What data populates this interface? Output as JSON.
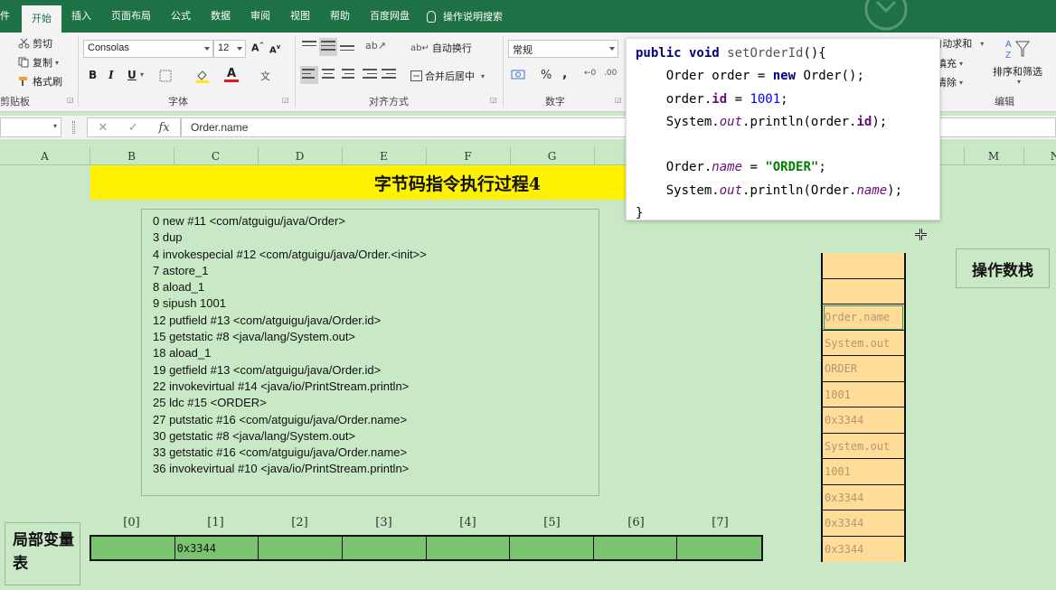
{
  "ribbon": {
    "tabs": [
      "件",
      "开始",
      "插入",
      "页面布局",
      "公式",
      "数据",
      "审阅",
      "视图",
      "帮助",
      "百度网盘",
      "操作说明搜索"
    ],
    "active_tab": "开始",
    "clipboard": {
      "cut": "剪切",
      "copy": "复制",
      "painter": "格式刷",
      "label": "剪贴板"
    },
    "font": {
      "name": "Consolas",
      "size": "12",
      "label": "字体",
      "bold": "B",
      "italic": "I",
      "underline": "U"
    },
    "align": {
      "wrap": "自动换行",
      "merge": "合并后居中",
      "label": "对齐方式"
    },
    "number": {
      "format": "常规",
      "percent": "%",
      "comma": ",",
      "label": "数字"
    },
    "edit": {
      "autosum": "自动求和",
      "fill": "填充",
      "clear": "清除",
      "sort": "排序和筛选",
      "label": "编辑"
    }
  },
  "formula_bar": {
    "cancel": "✕",
    "confirm": "✓",
    "fx": "fx",
    "content": "Order.name"
  },
  "columns": [
    "A",
    "B",
    "C",
    "D",
    "E",
    "F",
    "G",
    "M",
    "N"
  ],
  "sheet_title": "字节码指令执行过程4",
  "instructions": [
    "0 new #11 <com/atguigu/java/Order>",
    "3 dup",
    "4 invokespecial #12 <com/atguigu/java/Order.<init>>",
    "7 astore_1",
    "8 aload_1",
    "9 sipush 1001",
    "12 putfield #13 <com/atguigu/java/Order.id>",
    "15 getstatic #8 <java/lang/System.out>",
    "18 aload_1",
    "19 getfield #13 <com/atguigu/java/Order.id>",
    "22 invokevirtual #14 <java/io/PrintStream.println>",
    "25 ldc #15 <ORDER>",
    "27 putstatic #16 <com/atguigu/java/Order.name>",
    "30 getstatic #8 <java/lang/System.out>",
    "33 getstatic #16 <com/atguigu/java/Order.name>",
    "36 invokevirtual #10 <java/io/PrintStream.println>"
  ],
  "operand_stack": {
    "label": "操作数栈",
    "cells": [
      "",
      "",
      "Order.name",
      "System.out",
      "ORDER",
      "1001",
      "0x3344",
      "System.out",
      "1001",
      "0x3344",
      "0x3344",
      "0x3344"
    ]
  },
  "local_vars": {
    "label": "局部变量表",
    "indices": [
      "[0]",
      "[1]",
      "[2]",
      "[3]",
      "[4]",
      "[5]",
      "[6]",
      "[7]"
    ],
    "values": [
      "",
      "0x3344",
      "",
      "",
      "",
      "",
      "",
      ""
    ]
  },
  "code": {
    "l1_kw": "public void ",
    "l1_fn": "setOrderId",
    "l1_rest": "(){",
    "l2_a": "    Order order = ",
    "l2_kw": "new",
    "l2_b": " Order();",
    "l3_a": "    order.",
    "l3_f": "id",
    "l3_b": " = ",
    "l3_n": "1001",
    "l3_c": ";",
    "l4_a": "    System.",
    "l4_it": "out",
    "l4_b": ".println(order.",
    "l4_f": "id",
    "l4_c": ");",
    "l6_a": "    Order.",
    "l6_it": "name",
    "l6_b": " = ",
    "l6_s": "\"ORDER\"",
    "l6_c": ";",
    "l7_a": "    System.",
    "l7_it": "out",
    "l7_b": ".println(Order.",
    "l7_it2": "name",
    "l7_c": ");",
    "l8": "}"
  },
  "colors": {
    "ribbon": "#1e7145",
    "sheet": "#c9e8c5",
    "title": "#fff200",
    "stack": "#ffdd98",
    "local": "#7ac46f"
  }
}
